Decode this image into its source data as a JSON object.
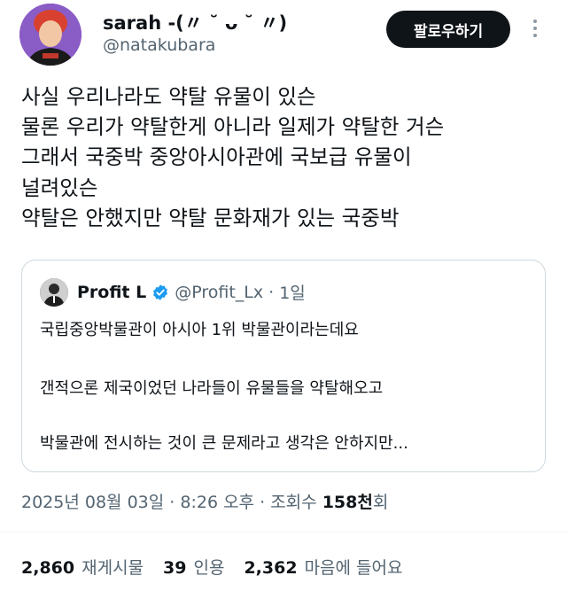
{
  "author": {
    "display_name": "sarah -(〃 ˘ ᴗ ˘ 〃)",
    "handle": "@natakubara",
    "follow_label": "팔로우하기"
  },
  "tweet": {
    "lines": [
      "사실 우리나라도 약탈 유물이 있슨",
      "물론 우리가 약탈한게 아니라 일제가 약탈한 거슨",
      "그래서 국중박 중앙아시아관에 국보급 유물이",
      "널려있슨",
      "약탈은 안했지만 약탈 문화재가 있는 국중박"
    ]
  },
  "quote": {
    "name": "Profit L",
    "handle": "@Profit_Lx",
    "separator": "·",
    "time": "1일",
    "lines": [
      "국립중앙박물관이 아시아 1위 박물관이라는데요",
      "갠적으론 제국이었던 나라들이 유물들을 약탈해오고",
      "박물관에 전시하는 것이 큰 문제라고 생각은 안하지만..."
    ]
  },
  "meta": {
    "date": "2025년 08월 03일",
    "time": "8:26 오후",
    "views_label": "조회수",
    "views_count": "158천",
    "views_suffix": "회"
  },
  "stats": {
    "reposts": {
      "count": "2,860",
      "label": "재게시물"
    },
    "quotes": {
      "count": "39",
      "label": "인용"
    },
    "likes": {
      "count": "2,362",
      "label": "마음에 들어요"
    }
  },
  "colors": {
    "accent_verified": "#1d9bf0",
    "secondary_text": "#536471",
    "avatar_bg": "#8a5cc6",
    "hair": "#d8412f"
  },
  "icons": [
    "more-options-icon",
    "verified-badge-icon"
  ]
}
